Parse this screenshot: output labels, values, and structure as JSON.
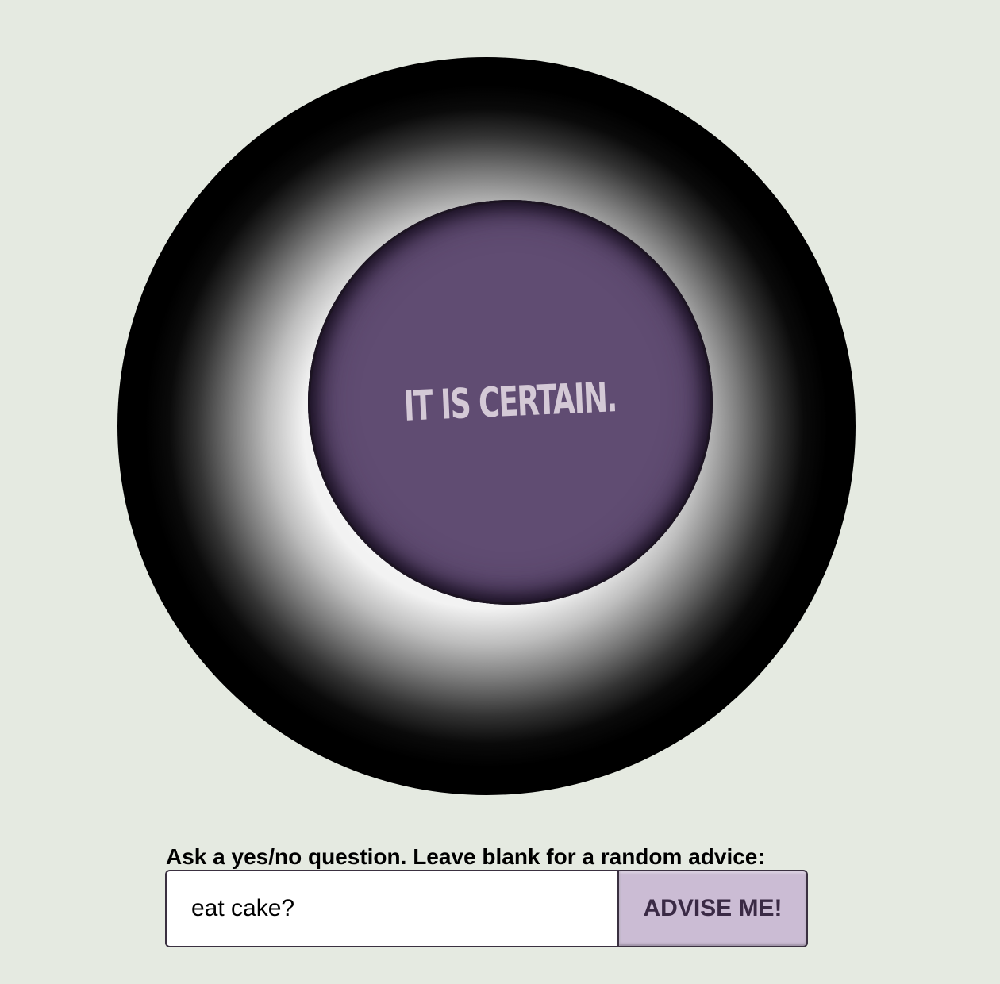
{
  "ball": {
    "answer": "IT IS CERTAIN."
  },
  "form": {
    "label": "Ask a yes/no question. Leave blank for a random advice:",
    "question_value": "eat cake?",
    "button_label": "ADVISE ME!"
  },
  "colors": {
    "page_background": "#e5eae1",
    "ball": "#000000",
    "answer_window": "#604c72",
    "answer_text": "#d4c9d6",
    "button_background": "#cbbcd4",
    "button_text": "#3a2a45"
  }
}
